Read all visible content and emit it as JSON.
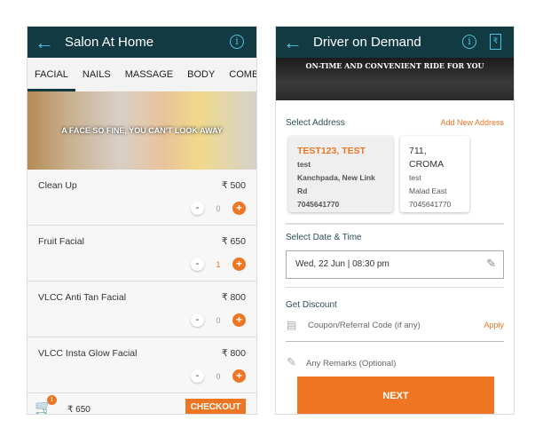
{
  "salon": {
    "title": "Salon At Home",
    "tabs": [
      "FACIAL",
      "NAILS",
      "MASSAGE",
      "BODY",
      "COMBO"
    ],
    "banner_text": "A FACE SO FINE, YOU CAN'T LOOK AWAY",
    "items": [
      {
        "name": "Clean Up",
        "price": "₹ 500",
        "qty": "0"
      },
      {
        "name": "Fruit Facial",
        "price": "₹ 650",
        "qty": "1"
      },
      {
        "name": "VLCC Anti Tan Facial",
        "price": "₹ 800",
        "qty": "0"
      },
      {
        "name": "VLCC Insta Glow Facial",
        "price": "₹ 800",
        "qty": "0"
      }
    ],
    "cart_count": "1",
    "total": "₹ 650",
    "checkout_label": "CHECKOUT"
  },
  "driver": {
    "title": "Driver on Demand",
    "banner_text": "ON-TIME AND CONVENIENT RIDE FOR YOU",
    "select_address_label": "Select Address",
    "add_address_label": "Add New Address",
    "addresses": [
      {
        "name": "TEST123, TEST",
        "line1": "test",
        "line2": "Kanchpada, New Link Rd",
        "phone": "7045641770"
      },
      {
        "name": "711, CROMA",
        "line1": "test",
        "line2": "Malad East",
        "phone": "7045641770"
      }
    ],
    "date_label": "Select Date & Time",
    "date_value": "Wed, 22 Jun | 08:30 pm",
    "discount_label": "Get Discount",
    "coupon_placeholder": "Coupon/Referral Code (if any)",
    "apply_label": "Apply",
    "remarks_placeholder": "Any Remarks (Optional)",
    "next_label": "NEXT"
  },
  "colors": {
    "header": "#123a42",
    "accent": "#ee7623",
    "icon": "#4fc3e0"
  }
}
